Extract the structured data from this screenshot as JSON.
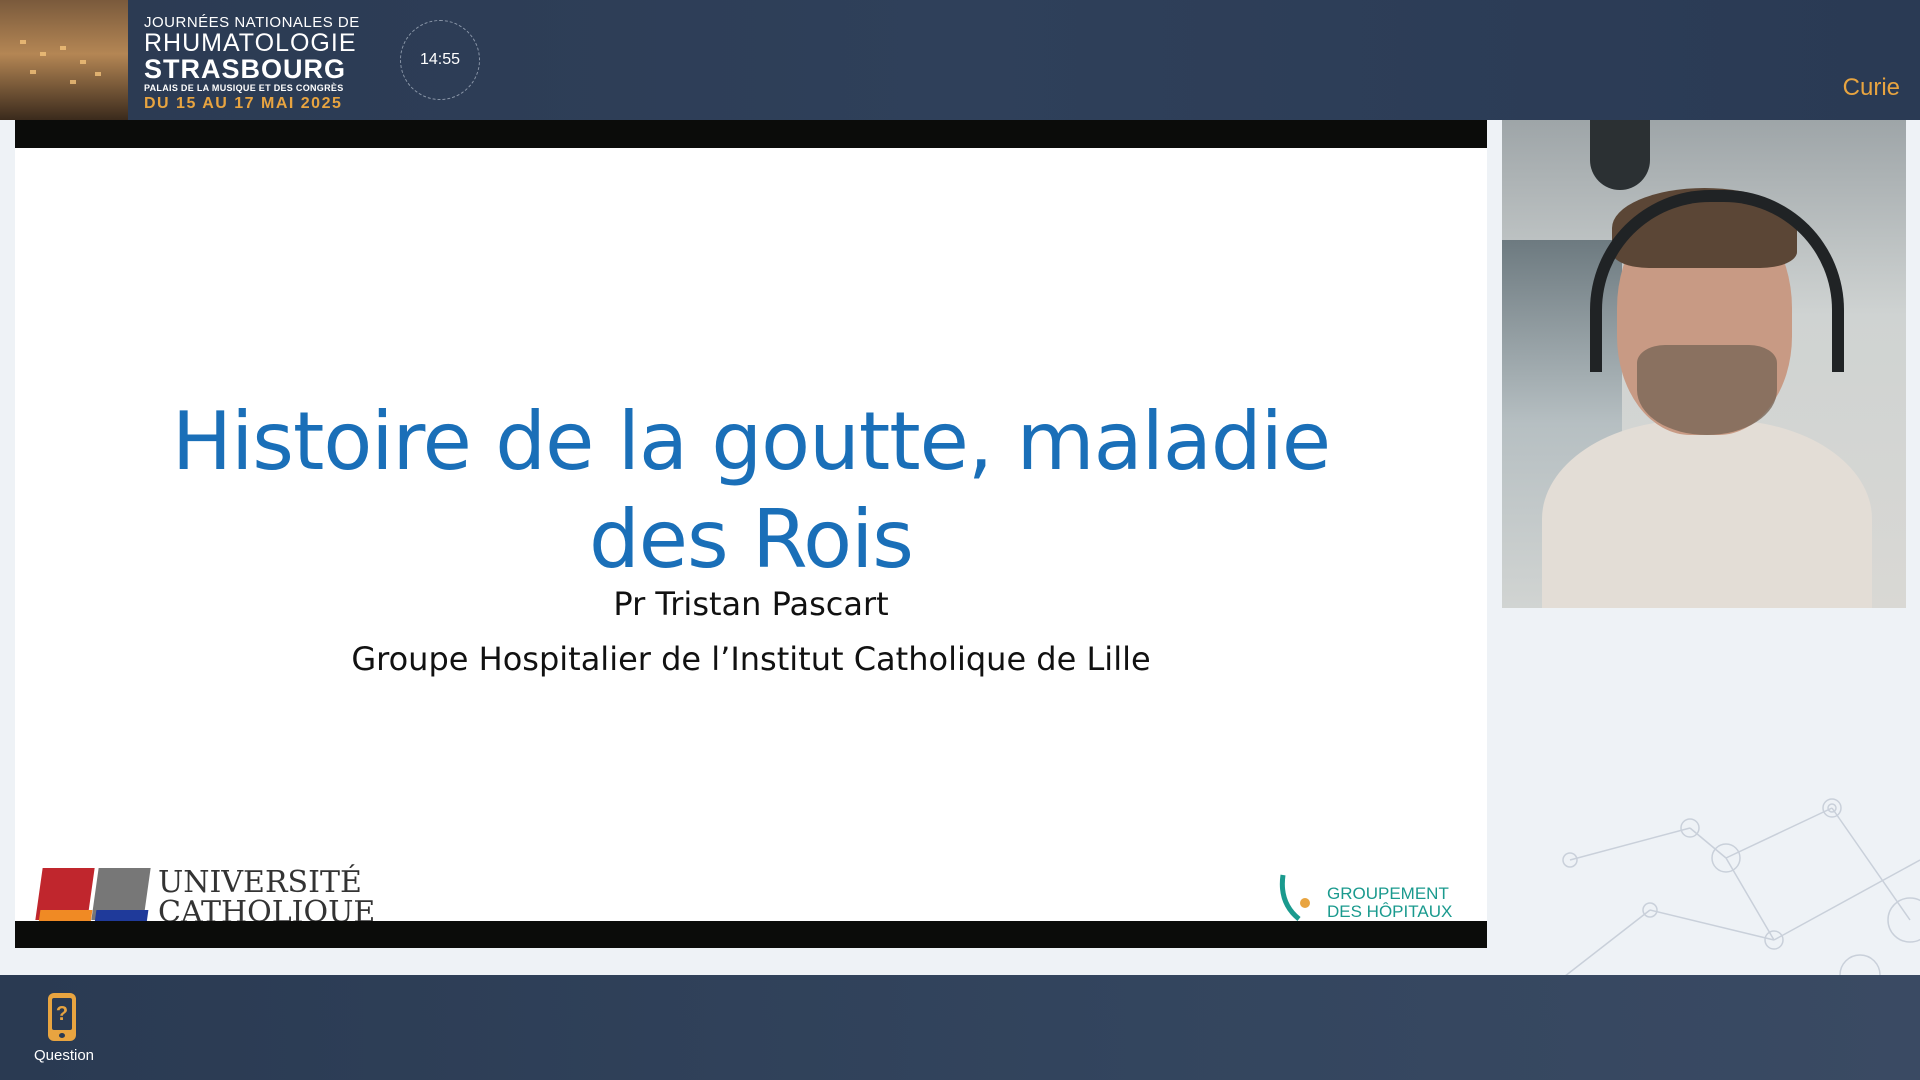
{
  "header": {
    "brand_line1": "JOURNÉES NATIONALES DE",
    "brand_line2": "RHUMATOLOGIE",
    "brand_line3": "STRASBOURG",
    "brand_line4": "PALAIS DE LA MUSIQUE ET DES CONGRÈS",
    "brand_dates": "DU 15 AU 17 MAI 2025",
    "clock": "14:55",
    "room": "Curie"
  },
  "slide": {
    "title_line1": "Histoire de la goutte, maladie",
    "title_line2": "des Rois",
    "author": "Pr Tristan Pascart",
    "institution": "Groupe Hospitalier de l’Institut Catholique de Lille",
    "logo_left_line1": "UNIVERSITÉ",
    "logo_left_line2": "CATHOLIQUE",
    "logo_right_line1": "GROUPEMENT",
    "logo_right_line2": "DES HÔPITAUX"
  },
  "footer": {
    "question_label": "Question",
    "question_icon": "phone-question-icon"
  },
  "colors": {
    "accent": "#e8a440",
    "title_blue": "#1a6fb8",
    "header_bg": "#2b3a52"
  }
}
